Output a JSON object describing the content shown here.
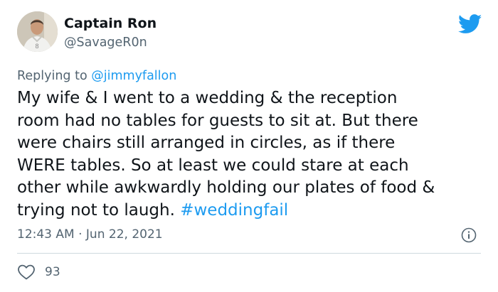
{
  "author": {
    "display_name": "Captain Ron",
    "handle": "@SavageR0n",
    "jersey_number": "8"
  },
  "reply": {
    "prefix": "Replying to",
    "mention": "@jimmyfallon"
  },
  "tweet": {
    "lines": [
      "My wife & I went to a wedding & the reception",
      "room had no tables for guests to sit at. But there",
      "were chairs still arranged in circles, as if there",
      "WERE tables. So at least we could stare at each",
      "other while awkwardly holding our plates of food &",
      "trying not to laugh."
    ],
    "hashtag": "#weddingfail"
  },
  "meta": {
    "time": "12:43 AM",
    "separator": "·",
    "date": "Jun 22, 2021"
  },
  "engagement": {
    "likes": "93"
  },
  "colors": {
    "accent": "#1d9bf0",
    "secondary_text": "#536471",
    "divider": "#cfd9de"
  },
  "icons": {
    "platform": "twitter-bird-icon",
    "info": "info-icon",
    "like": "heart-icon"
  }
}
